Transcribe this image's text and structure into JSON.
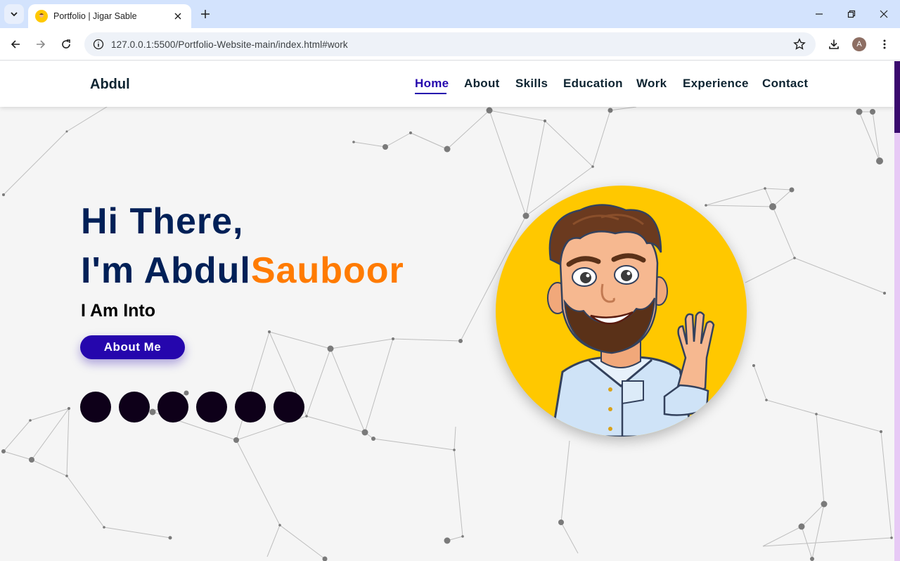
{
  "browser": {
    "tab_title": "Portfolio | Jigar Sable",
    "url": "127.0.0.1:5500/Portfolio-Website-main/index.html#work",
    "profile_initial": "A"
  },
  "site": {
    "logo": "Abdul",
    "nav": [
      {
        "label": "Home"
      },
      {
        "label": "About"
      },
      {
        "label": "Skills"
      },
      {
        "label": "Education"
      },
      {
        "label": "Work"
      },
      {
        "label": "Experience"
      },
      {
        "label": "Contact"
      }
    ],
    "hero": {
      "greeting": "Hi There,",
      "name_prefix": "I'm Abdul",
      "name_accent": "Sauboor",
      "into": "I Am Into",
      "button": "About Me"
    },
    "socials_count": 6
  },
  "colors": {
    "primary": "#2506ad",
    "heading": "#002057",
    "accent": "#ff7b00",
    "avatar_bg": "#ffc800",
    "scroll_thumb": "#3a0a6e"
  },
  "icons": [
    "tab-search-icon",
    "close-icon",
    "plus-icon",
    "minimize-icon",
    "restore-icon",
    "back-arrow-icon",
    "forward-arrow-icon",
    "reload-icon",
    "site-info-icon",
    "star-icon",
    "download-icon",
    "kebab-menu-icon"
  ]
}
